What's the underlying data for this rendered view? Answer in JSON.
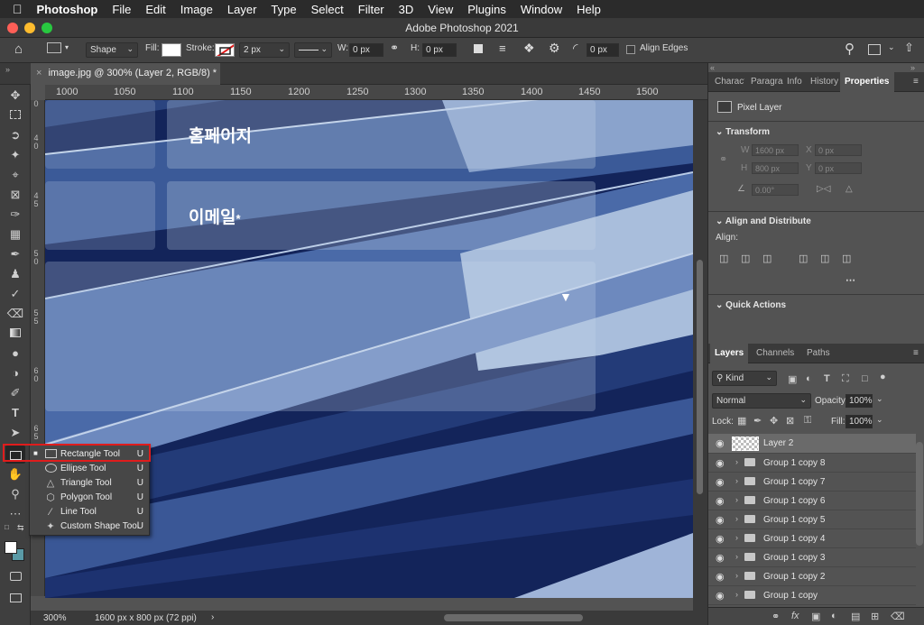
{
  "menubar": {
    "app": "Photoshop",
    "items": [
      "File",
      "Edit",
      "Image",
      "Layer",
      "Type",
      "Select",
      "Filter",
      "3D",
      "View",
      "Plugins",
      "Window",
      "Help"
    ]
  },
  "window": {
    "title": "Adobe Photoshop 2021"
  },
  "options": {
    "shape_mode": "Shape",
    "fill_label": "Fill:",
    "stroke_label": "Stroke:",
    "stroke_width": "2 px",
    "w_label": "W:",
    "w_value": "0 px",
    "h_label": "H:",
    "h_value": "0 px",
    "radius": "0 px",
    "align_edges": "Align Edges"
  },
  "document": {
    "tab": "image.jpg @ 300% (Layer 2, RGB/8) *"
  },
  "ruler": {
    "h": [
      "1000",
      "1050",
      "1100",
      "1150",
      "1200",
      "1250",
      "1300",
      "1350",
      "1400",
      "1450",
      "1500"
    ],
    "v": [
      "0",
      "4 0",
      "4 5",
      "5 0",
      "5 5",
      "6 0",
      "6 5"
    ]
  },
  "canvas": {
    "field1": "홈페이지",
    "field2": "이메일",
    "required": "*"
  },
  "flyout": {
    "items": [
      {
        "name": "Rectangle Tool",
        "key": "U",
        "icon": "rectangle-icon"
      },
      {
        "name": "Ellipse Tool",
        "key": "U",
        "icon": "ellipse-icon"
      },
      {
        "name": "Triangle Tool",
        "key": "U",
        "icon": "triangle-icon"
      },
      {
        "name": "Polygon Tool",
        "key": "U",
        "icon": "polygon-icon"
      },
      {
        "name": "Line Tool",
        "key": "U",
        "icon": "line-icon"
      },
      {
        "name": "Custom Shape Tool",
        "key": "U",
        "icon": "custom-shape-icon"
      }
    ]
  },
  "status": {
    "zoom": "300%",
    "doc_size": "1600 px x 800 px (72 ppi)"
  },
  "panel_tabs": [
    "Charact",
    "Paragra",
    "Info",
    "History",
    "Properties"
  ],
  "properties": {
    "type": "Pixel Layer",
    "transform": "Transform",
    "w_label": "W",
    "w_value": "1600 px",
    "h_label": "H",
    "h_value": "800 px",
    "x_label": "X",
    "x_value": "0 px",
    "y_label": "Y",
    "y_value": "0 px",
    "angle": "0.00°",
    "align_title": "Align and Distribute",
    "align_label": "Align:",
    "quick_actions": "Quick Actions"
  },
  "layers_tabs": [
    "Layers",
    "Channels",
    "Paths"
  ],
  "layers": {
    "filter": "Kind",
    "blend": "Normal",
    "opacity_label": "Opacity:",
    "opacity": "100%",
    "lock_label": "Lock:",
    "fill_label": "Fill:",
    "fill": "100%",
    "items": [
      "Layer 2",
      "Group 1 copy 8",
      "Group 1 copy 7",
      "Group 1 copy 6",
      "Group 1 copy 5",
      "Group 1 copy 4",
      "Group 1 copy 3",
      "Group 1 copy 2",
      "Group 1 copy"
    ]
  },
  "colors": {
    "highlight": "#e01c1c",
    "panel": "#535353",
    "canvas_blue": "#1c2d63"
  }
}
